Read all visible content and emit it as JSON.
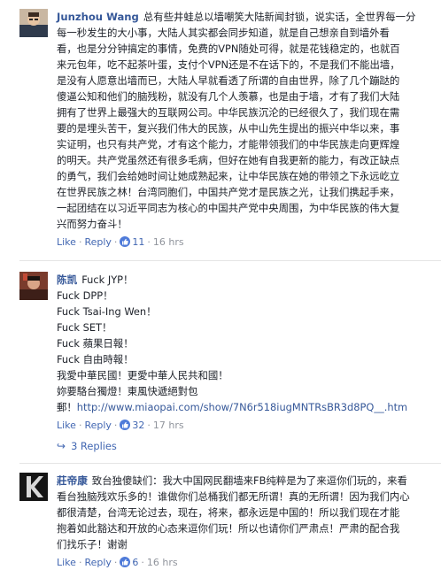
{
  "comments": [
    {
      "author": "Junzhou Wang",
      "lines": [
        "总有些井蛙总以墙嘲笑大陆新闻封锁，说实话，全世界每一分",
        "每一秒发生的大小事，大陆人其实都会同步知道，就是自己想亲自到墙外看",
        "看，也是分分钟搞定的事情，免费的VPN随处可得，就是花钱稳定的，也就百",
        "来元包年，吃不起茶叶蛋，支付个VPN还是不在话下的，不是我们不能出墙，",
        "是没有人愿意出墙而已，大陆人早就看透了所谓的自由世界，除了几个蹦跶的",
        "傻逼公知和他们的脑残粉，就没有几个人羡慕，也是由于墙，才有了我们大陆",
        "拥有了世界上最强大的互联网公司。中华民族沉沦的已经很久了，我们现在需",
        "要的是埋头苦干，复兴我们伟大的民族，从中山先生提出的振兴中华以来，事",
        "实证明，也只有共产党，才有这个能力，才能带领我们的中华民族走向更辉煌",
        "的明天。共产党虽然还有很多毛病，但好在她有自我更新的能力，有改正缺点",
        "的勇气，我们会给她时间让她成熟起来，让中华民族在她的带领之下永远屹立",
        "在世界民族之林！台湾同胞们，中国共产党才是民族之光，让我们携起手来，",
        "一起团结在以习近平同志为核心的中国共产党中央周围，为中华民族的伟大复",
        "兴而努力奋斗！"
      ],
      "like": "Like",
      "reply": "Reply",
      "count": "11",
      "time": "16 hrs",
      "link": null
    },
    {
      "author": "陈凯",
      "lines": [
        "Fuck JYP！",
        "Fuck DPP！",
        "Fuck Tsai-Ing Wen！",
        "Fuck SET！",
        "Fuck 蘋果日報！",
        "Fuck 自由時報！",
        "我愛中華民國！更愛中華人民共和國！",
        "妳要駱台獨燈！東風快遞絕對包",
        "郵！"
      ],
      "link": "http://www.miaopai.com/show/7N6r518iugMNTRsBR3d8PQ__.htm",
      "like": "Like",
      "reply": "Reply",
      "count": "32",
      "time": "17 hrs",
      "replies": "3 Replies"
    },
    {
      "author": "莊帝康",
      "lines": [
        "致台独傻缺们：我大中国网民翻墙来FB纯粹是为了来逗你们玩的，来看",
        "看台独脑残欢乐多的！谁做你们总桶我们都无所谓！真的无所谓！因为我们内心",
        "都很清楚，台湾无论过去，现在，将来，都永远是中国的！所以我们现在才能",
        "抱着如此豁达和开放的心态来逗你们玩！所以也请你们严肃点！严肃的配合我",
        "们找乐子！谢谢"
      ],
      "like": "Like",
      "reply": "Reply",
      "count": "6",
      "time": "16 hrs",
      "link": null
    }
  ],
  "ui": {
    "dot": "·",
    "reply_arrow": "↪"
  },
  "colors": {
    "link": "#365899",
    "meta": "#90949c",
    "like_blue": "#4f7bd9"
  }
}
